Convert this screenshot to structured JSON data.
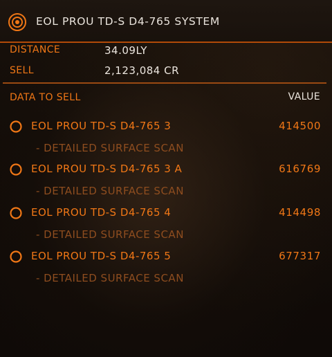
{
  "header": {
    "system_name": "EOL PROU TD-S D4-765 SYSTEM",
    "icon": "system-target-icon"
  },
  "info": {
    "distance_label": "DISTANCE",
    "distance_value": "34.09LY",
    "sell_label": "SELL",
    "sell_value": "2,123,084 CR"
  },
  "table": {
    "data_header": "DATA TO SELL",
    "value_header": "VALUE",
    "items": [
      {
        "name": "EOL PROU TD-S D4-765 3",
        "value": "414500",
        "sub": "- DETAILED SURFACE SCAN",
        "icon": "planet-ring-icon"
      },
      {
        "name": "EOL PROU TD-S D4-765 3 A",
        "value": "616769",
        "sub": "- DETAILED SURFACE SCAN",
        "icon": "planet-ring-icon"
      },
      {
        "name": "EOL PROU TD-S D4-765 4",
        "value": "414498",
        "sub": "- DETAILED SURFACE SCAN",
        "icon": "planet-ring-icon"
      },
      {
        "name": "EOL PROU TD-S D4-765 5",
        "value": "677317",
        "sub": "- DETAILED SURFACE SCAN",
        "icon": "planet-ring-icon"
      }
    ]
  },
  "colors": {
    "accent": "#f07716",
    "divider": "#9b4a12",
    "text": "#ece6df",
    "muted": "#8e4d1f"
  }
}
